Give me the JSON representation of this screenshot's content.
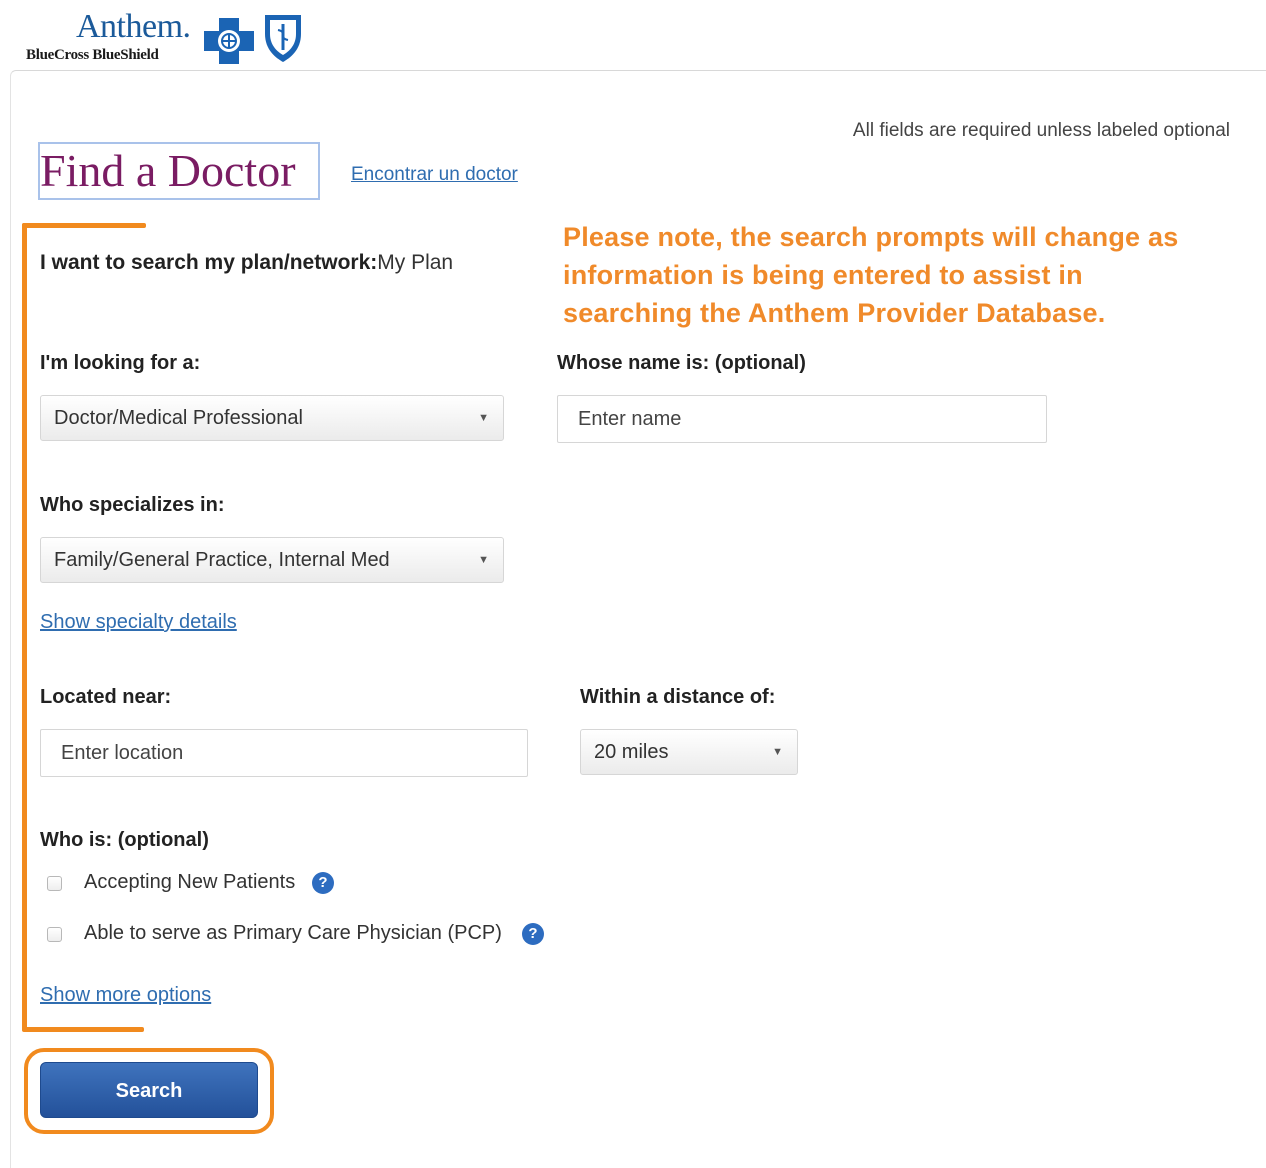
{
  "header": {
    "brand_name": "Anthem.",
    "brand_sub": "BlueCross BlueShield",
    "logo_icons": [
      "blue-cross-icon",
      "blue-shield-icon"
    ]
  },
  "form": {
    "required_note": "All fields are required unless labeled optional",
    "title": "Find a Doctor",
    "spanish_link": "Encontrar un doctor",
    "plan_label": "I want to search my plan/network:",
    "plan_value": "My Plan",
    "looking_for_label": "I'm looking for a:",
    "looking_for_value": "Doctor/Medical Professional",
    "name_label": "Whose name is: (optional)",
    "name_placeholder": "Enter name",
    "specialty_label": "Who specializes in:",
    "specialty_value": "Family/General Practice, Internal Med",
    "specialty_details_link": "Show specialty details",
    "location_label": "Located near:",
    "location_placeholder": "Enter location",
    "distance_label": "Within a distance of:",
    "distance_value": "20 miles",
    "who_is_label": "Who is: (optional)",
    "options": [
      {
        "label": "Accepting New Patients",
        "checked": false
      },
      {
        "label": "Able to serve as Primary Care Physician (PCP)",
        "checked": false
      }
    ],
    "help_glyph": "?",
    "caret_glyph": "▼",
    "more_options_link": "Show more options",
    "search_button": "Search"
  },
  "annotation": {
    "text_lines": [
      "Please note, the search prompts will change as",
      "information is being entered to assist in",
      "searching the Anthem Provider Database."
    ],
    "color": "#f08a2a"
  },
  "colors": {
    "brand_blue": "#1b5a9a",
    "title_purple": "#7a1c63",
    "link_blue": "#2f6db0",
    "button_blue": "#2d5fa8",
    "annotation_orange": "#f18a1e"
  }
}
